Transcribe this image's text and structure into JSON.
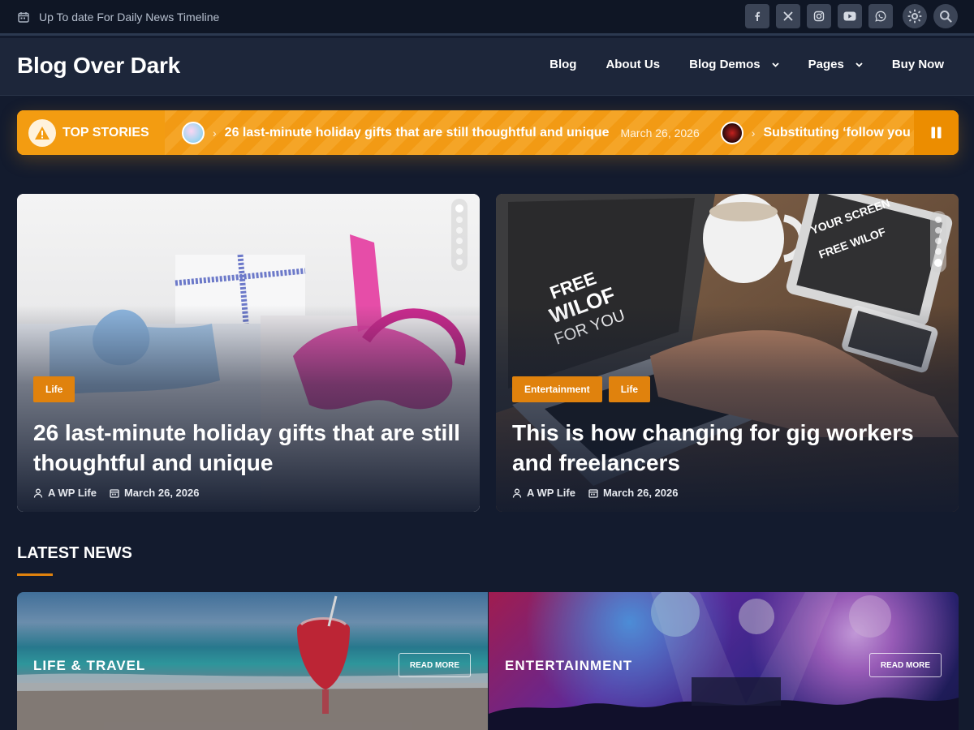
{
  "topbar": {
    "tagline": "Up To date For Daily News Timeline",
    "social_icons": [
      "facebook-icon",
      "x-icon",
      "instagram-icon",
      "youtube-icon",
      "whatsapp-icon"
    ],
    "utility_icons": [
      "theme-toggle-icon",
      "search-icon"
    ]
  },
  "header": {
    "brand": "Blog Over Dark",
    "nav": [
      {
        "label": "Blog",
        "dropdown": false
      },
      {
        "label": "About Us",
        "dropdown": false
      },
      {
        "label": "Blog Demos",
        "dropdown": true
      },
      {
        "label": "Pages",
        "dropdown": true
      },
      {
        "label": "Buy Now",
        "dropdown": false
      }
    ]
  },
  "ticker": {
    "label": "TOP STORIES",
    "items": [
      {
        "title": "26 last-minute holiday gifts that are still thoughtful and unique",
        "date": "March 26, 2026"
      },
      {
        "title": "Substituting ‘follow you",
        "date": ""
      }
    ]
  },
  "featured": [
    {
      "tags": [
        "Life"
      ],
      "title": "26 last-minute holiday gifts that are still thoughtful and unique",
      "author": "A WP Life",
      "date": "March 26, 2026",
      "slides": 6,
      "active_slide": 1
    },
    {
      "tags": [
        "Entertainment",
        "Life"
      ],
      "title": "This is how changing for gig workers and freelancers",
      "author": "A WP Life",
      "date": "March 26, 2026",
      "slides": 5,
      "active_slide": 5
    }
  ],
  "latest": {
    "heading": "LATEST NEWS",
    "cards": [
      {
        "category": "LIFE & TRAVEL",
        "button": "READ MORE"
      },
      {
        "category": "ENTERTAINMENT",
        "button": "READ MORE"
      }
    ]
  },
  "colors": {
    "accent": "#e0820d",
    "ticker": "#f39c11",
    "background": "#131b2e",
    "header": "#1d263a"
  }
}
